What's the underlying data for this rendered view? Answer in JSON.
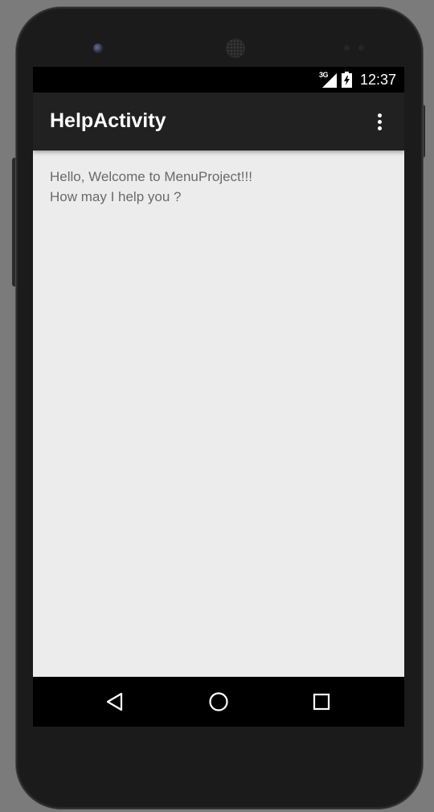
{
  "status_bar": {
    "network": "3G",
    "time": "12:37"
  },
  "app_bar": {
    "title": "HelpActivity",
    "overflow_icon": "more-vert-icon"
  },
  "content": {
    "line1": "Hello, Welcome to MenuProject!!!",
    "line2": "How may I help you ?"
  },
  "nav_bar": {
    "back_icon": "back-triangle-icon",
    "home_icon": "home-circle-icon",
    "recents_icon": "recents-square-icon"
  },
  "colors": {
    "app_bar": "#212121",
    "content_bg": "#ececec",
    "content_text": "#6a6a6a",
    "device_body": "#1b1b1b",
    "backdrop": "#7b7b7b"
  }
}
